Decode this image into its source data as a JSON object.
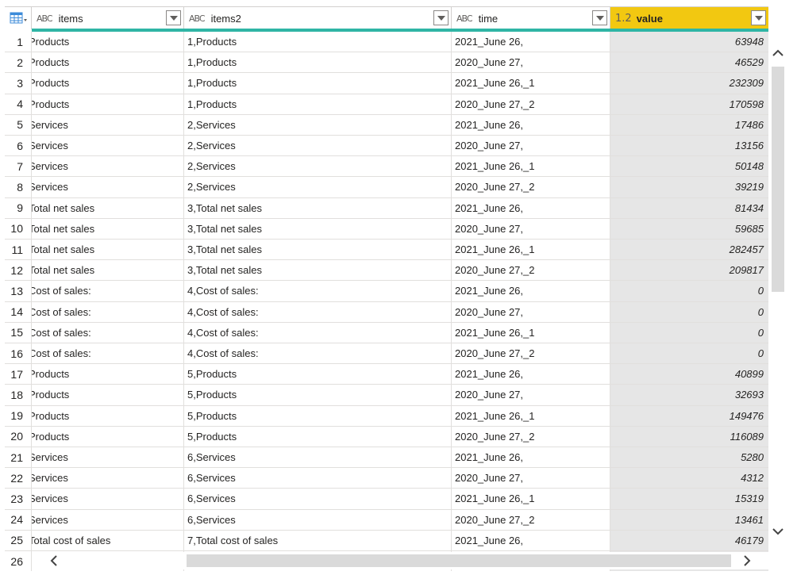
{
  "columns": [
    {
      "type_icon": "ABC",
      "label": "items"
    },
    {
      "type_icon": "ABC",
      "label": "items2"
    },
    {
      "type_icon": "ABC",
      "label": "time"
    },
    {
      "type_icon": "1.2",
      "label": "value"
    }
  ],
  "rows": [
    {
      "n": "1",
      "items": "Products",
      "items2": "1,Products",
      "time": "2021_June 26,",
      "value": "63948"
    },
    {
      "n": "2",
      "items": "Products",
      "items2": "1,Products",
      "time": "2020_June 27,",
      "value": "46529"
    },
    {
      "n": "3",
      "items": "Products",
      "items2": "1,Products",
      "time": "2021_June 26,_1",
      "value": "232309"
    },
    {
      "n": "4",
      "items": "Products",
      "items2": "1,Products",
      "time": "2020_June 27,_2",
      "value": "170598"
    },
    {
      "n": "5",
      "items": "Services",
      "items2": "2,Services",
      "time": "2021_June 26,",
      "value": "17486"
    },
    {
      "n": "6",
      "items": "Services",
      "items2": "2,Services",
      "time": "2020_June 27,",
      "value": "13156"
    },
    {
      "n": "7",
      "items": "Services",
      "items2": "2,Services",
      "time": "2021_June 26,_1",
      "value": "50148"
    },
    {
      "n": "8",
      "items": "Services",
      "items2": "2,Services",
      "time": "2020_June 27,_2",
      "value": "39219"
    },
    {
      "n": "9",
      "items": "Total net sales",
      "items2": "3,Total net sales",
      "time": "2021_June 26,",
      "value": "81434"
    },
    {
      "n": "10",
      "items": "Total net sales",
      "items2": "3,Total net sales",
      "time": "2020_June 27,",
      "value": "59685"
    },
    {
      "n": "11",
      "items": "Total net sales",
      "items2": "3,Total net sales",
      "time": "2021_June 26,_1",
      "value": "282457"
    },
    {
      "n": "12",
      "items": "Total net sales",
      "items2": "3,Total net sales",
      "time": "2020_June 27,_2",
      "value": "209817"
    },
    {
      "n": "13",
      "items": "Cost of sales:",
      "items2": "4,Cost of sales:",
      "time": "2021_June 26,",
      "value": "0"
    },
    {
      "n": "14",
      "items": "Cost of sales:",
      "items2": "4,Cost of sales:",
      "time": "2020_June 27,",
      "value": "0"
    },
    {
      "n": "15",
      "items": "Cost of sales:",
      "items2": "4,Cost of sales:",
      "time": "2021_June 26,_1",
      "value": "0"
    },
    {
      "n": "16",
      "items": "Cost of sales:",
      "items2": "4,Cost of sales:",
      "time": "2020_June 27,_2",
      "value": "0"
    },
    {
      "n": "17",
      "items": "Products",
      "items2": "5,Products",
      "time": "2021_June 26,",
      "value": "40899"
    },
    {
      "n": "18",
      "items": "Products",
      "items2": "5,Products",
      "time": "2020_June 27,",
      "value": "32693"
    },
    {
      "n": "19",
      "items": "Products",
      "items2": "5,Products",
      "time": "2021_June 26,_1",
      "value": "149476"
    },
    {
      "n": "20",
      "items": "Products",
      "items2": "5,Products",
      "time": "2020_June 27,_2",
      "value": "116089"
    },
    {
      "n": "21",
      "items": "Services",
      "items2": "6,Services",
      "time": "2021_June 26,",
      "value": "5280"
    },
    {
      "n": "22",
      "items": "Services",
      "items2": "6,Services",
      "time": "2020_June 27,",
      "value": "4312"
    },
    {
      "n": "23",
      "items": "Services",
      "items2": "6,Services",
      "time": "2021_June 26,_1",
      "value": "15319"
    },
    {
      "n": "24",
      "items": "Services",
      "items2": "6,Services",
      "time": "2020_June 27,_2",
      "value": "13461"
    },
    {
      "n": "25",
      "items": "Total cost of sales",
      "items2": "7,Total cost of sales",
      "time": "2021_June 26,",
      "value": "46179"
    },
    {
      "n": "26",
      "items": "",
      "items2": "",
      "time": "",
      "value": ""
    }
  ],
  "colors": {
    "selected_header": "#f2c811",
    "quality_bar": "#2fb5a5",
    "selected_column_fill": "#e6e6e6",
    "scroll_thumb": "#dadada"
  },
  "icons": {
    "corner": "table-menu-icon",
    "dropdown": "filter-dropdown-icon",
    "scroll_up": "chevron-up-icon",
    "scroll_down": "chevron-down-icon",
    "scroll_left": "chevron-left-icon",
    "scroll_right": "chevron-right-icon"
  }
}
